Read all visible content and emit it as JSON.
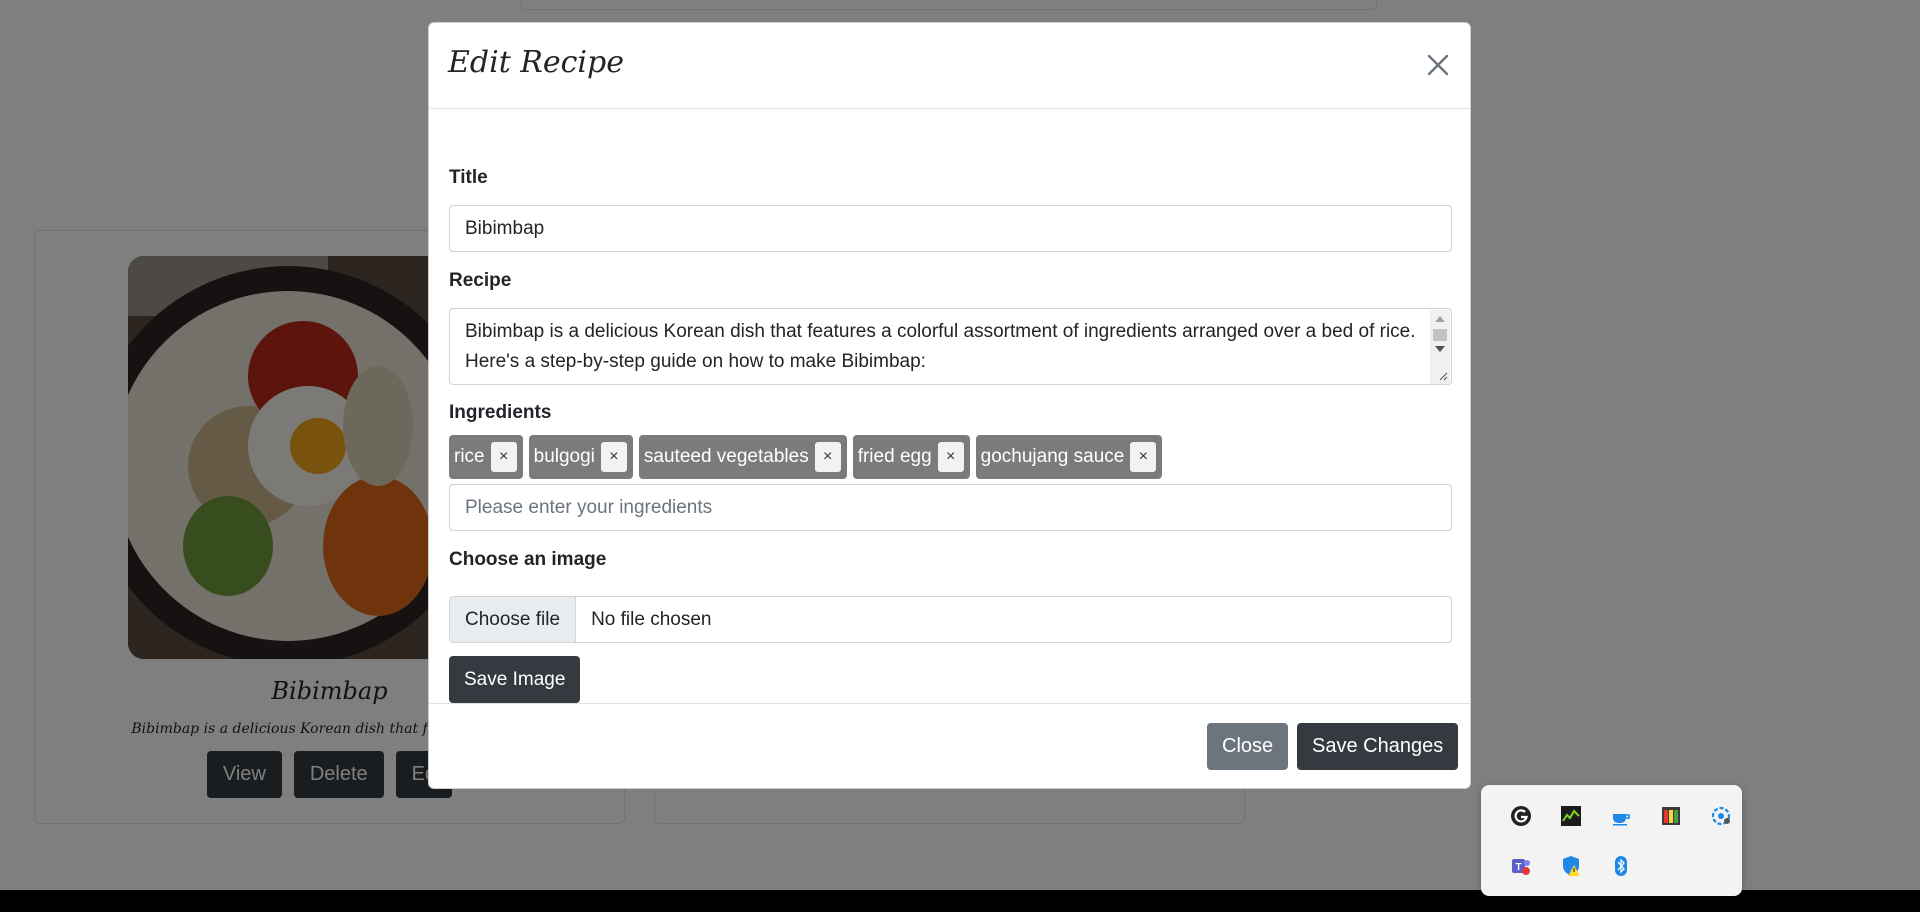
{
  "background": {
    "cards": [
      {
        "title": "Bibimbap",
        "text": "Bibimbap is a delicious Korean dish that features a colo",
        "buttons": [
          "View",
          "Delete",
          "Ed"
        ]
      },
      {
        "buttons": []
      }
    ]
  },
  "modal": {
    "title": "Edit Recipe",
    "title_label": "Title",
    "title_value": "Bibimbap",
    "recipe_label": "Recipe",
    "recipe_value": "Bibimbap is a delicious Korean dish that features a colorful assortment of ingredients arranged over a bed of rice. Here's a step-by-step guide on how to make Bibimbap:",
    "ingredients_label": "Ingredients",
    "ingredients": [
      "rice",
      "bulgogi",
      "sauteed vegetables",
      "fried egg",
      "gochujang sauce"
    ],
    "ingredient_remove_symbol": "×",
    "ingredients_placeholder": "Please enter your ingredients",
    "image_label": "Choose an image",
    "file_button": "Choose file",
    "file_status": "No file chosen",
    "save_image": "Save Image",
    "close": "Close",
    "save_changes": "Save Changes"
  },
  "tray": {
    "icons": [
      "logitech-g-icon",
      "gpu-monitor-icon",
      "coffee-cup-icon",
      "color-palette-icon",
      "network-settings-icon",
      "teams-icon",
      "defender-warning-icon",
      "bluetooth-icon"
    ]
  },
  "colors": {
    "dark_button": "#343a40",
    "secondary_button": "#6c757d",
    "tag": "#7b7b7b",
    "backdrop": "rgba(0,0,0,0.5)"
  }
}
